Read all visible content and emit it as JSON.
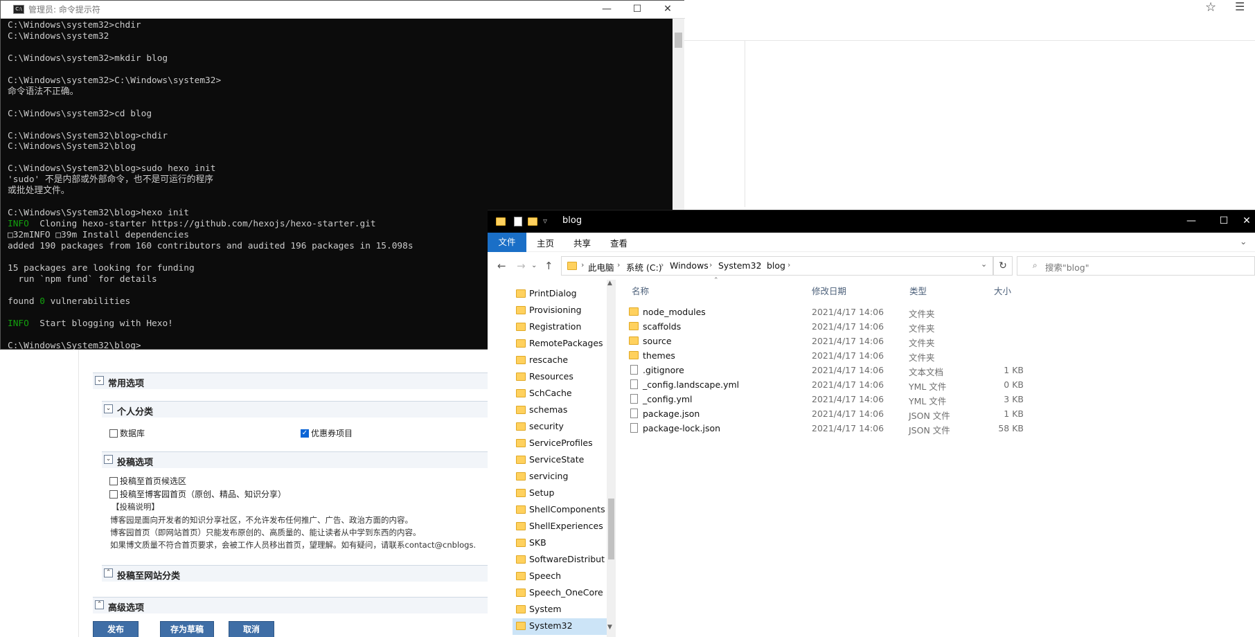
{
  "browser": {
    "star_icon": "star-icon",
    "menu_icon": "menu-icon"
  },
  "editor": {
    "sections": {
      "common": "常用选项",
      "personal": "个人分类",
      "submit": "投稿选项",
      "site_category": "投稿至网站分类",
      "advanced": "高级选项"
    },
    "checkboxes": {
      "database": "数据库",
      "coupon": "优惠券项目",
      "home_candidate": "投稿至首页候选区",
      "blog_home": "投稿至博客园首页（原创、精品、知识分享）"
    },
    "notes": [
      "【投稿说明】",
      "博客园是面向开发者的知识分享社区，不允许发布任何推广、广告、政治方面的内容。",
      "博客园首页（即网站首页）只能发布原创的、高质量的、能让读者从中学到东西的内容。",
      "如果博文质量不符合首页要求，会被工作人员移出首页，望理解。如有疑问，请联系contact@cnblogs."
    ],
    "buttons": {
      "publish": "发布",
      "save_draft": "存为草稿",
      "cancel": "取消"
    }
  },
  "cmd": {
    "title": "管理员: 命令提示符",
    "lines": [
      "C:\\Windows\\system32>chdir",
      "C:\\Windows\\system32",
      "",
      "C:\\Windows\\system32>mkdir blog",
      "",
      "C:\\Windows\\system32>C:\\Windows\\system32>",
      "命令语法不正确。",
      "",
      "C:\\Windows\\system32>cd blog",
      "",
      "C:\\Windows\\System32\\blog>chdir",
      "C:\\Windows\\System32\\blog",
      "",
      "C:\\Windows\\System32\\blog>sudo hexo init",
      "'sudo' 不是内部或外部命令，也不是可运行的程序",
      "或批处理文件。",
      "",
      "C:\\Windows\\System32\\blog>hexo init"
    ],
    "info_label": "INFO",
    "cloning": "  Cloning hexo-starter https://github.com/hexojs/hexo-starter.git",
    "install_line": "□32mINFO □39m Install dependencies",
    "lines2": [
      "added 190 packages from 160 contributors and audited 196 packages in 15.098s",
      "",
      "15 packages are looking for funding",
      "  run `npm fund` for details",
      ""
    ],
    "found_prefix": "found ",
    "found_zero": "0",
    "found_suffix": " vulnerabilities",
    "start": "  Start blogging with Hexo!",
    "prompt": "C:\\Windows\\System32\\blog>"
  },
  "explorer": {
    "title": "blog",
    "ribbon_tabs": [
      "文件",
      "主页",
      "共享",
      "查看"
    ],
    "breadcrumb": [
      "此电脑",
      "系统 (C:)",
      "Windows",
      "System32",
      "blog"
    ],
    "search_placeholder": "搜索\"blog\"",
    "nav_items": [
      "PrintDialog",
      "Provisioning",
      "Registration",
      "RemotePackages",
      "rescache",
      "Resources",
      "SchCache",
      "schemas",
      "security",
      "ServiceProfiles",
      "ServiceState",
      "servicing",
      "Setup",
      "ShellComponents",
      "ShellExperiences",
      "SKB",
      "SoftwareDistribut",
      "Speech",
      "Speech_OneCore",
      "System",
      "System32"
    ],
    "selected_nav": "System32",
    "columns": [
      "名称",
      "修改日期",
      "类型",
      "大小"
    ],
    "files": [
      {
        "name": "node_modules",
        "date": "2021/4/17 14:06",
        "type": "文件夹",
        "size": "",
        "kind": "folder"
      },
      {
        "name": "scaffolds",
        "date": "2021/4/17 14:06",
        "type": "文件夹",
        "size": "",
        "kind": "folder"
      },
      {
        "name": "source",
        "date": "2021/4/17 14:06",
        "type": "文件夹",
        "size": "",
        "kind": "folder"
      },
      {
        "name": "themes",
        "date": "2021/4/17 14:06",
        "type": "文件夹",
        "size": "",
        "kind": "folder"
      },
      {
        "name": ".gitignore",
        "date": "2021/4/17 14:06",
        "type": "文本文档",
        "size": "1 KB",
        "kind": "file"
      },
      {
        "name": "_config.landscape.yml",
        "date": "2021/4/17 14:06",
        "type": "YML 文件",
        "size": "0 KB",
        "kind": "file"
      },
      {
        "name": "_config.yml",
        "date": "2021/4/17 14:06",
        "type": "YML 文件",
        "size": "3 KB",
        "kind": "file"
      },
      {
        "name": "package.json",
        "date": "2021/4/17 14:06",
        "type": "JSON 文件",
        "size": "1 KB",
        "kind": "file"
      },
      {
        "name": "package-lock.json",
        "date": "2021/4/17 14:06",
        "type": "JSON 文件",
        "size": "58 KB",
        "kind": "file"
      }
    ]
  },
  "window_controls": {
    "minimize": "—",
    "maximize": "☐",
    "close": "✕"
  }
}
